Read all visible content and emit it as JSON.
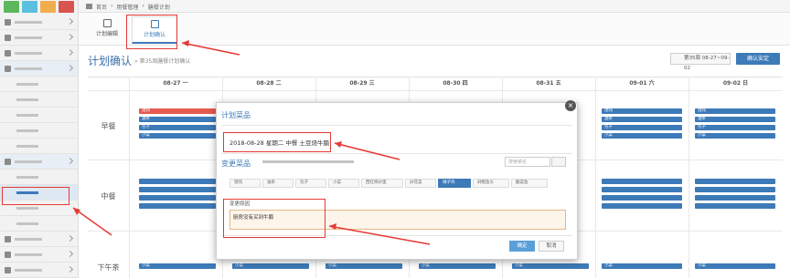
{
  "breadcrumb": {
    "items": [
      "首页",
      "用餐管理",
      "膳餐计划"
    ]
  },
  "tabs": [
    {
      "label": "计划编辑",
      "active": false
    },
    {
      "label": "计划确认",
      "active": true
    }
  ],
  "page": {
    "title": "计划确认",
    "subtitle": "» 第35周膳餐计划确认",
    "week_button": "第35周 08-27~09-02",
    "confirm_button": "确认安定"
  },
  "grid": {
    "days": [
      "08-27 一",
      "08-28 二",
      "08-29 三",
      "08-30 四",
      "08-31 五",
      "09-01 六",
      "09-02 日"
    ],
    "meals": [
      "早餐",
      "中餐",
      "下午茶"
    ]
  },
  "modal": {
    "title": "计划菜品",
    "selected_line": "2018-08-28 星期二 中餐 土豆烧牛腩",
    "change_title": "变更菜品",
    "search_placeholder": "搜索菜名",
    "reason_label": "变更原因",
    "reason_value": "厨房没有买到牛腩",
    "ok_label": "确定",
    "cancel_label": "取消",
    "options": [
      "馄饨",
      "油条",
      "包子",
      "小菜",
      "西红柿炒蛋",
      "炒花菜",
      "辣子鸡",
      "剁椒鱼头",
      "酸菜鱼"
    ]
  },
  "colors": {
    "accent": "#3d7ab8",
    "annotation": "#e53935",
    "highlight_tag": "#e55a4e"
  }
}
